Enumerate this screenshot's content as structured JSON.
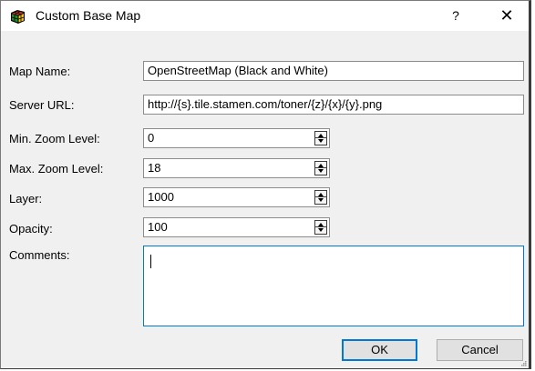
{
  "window": {
    "title": "Custom Base Map",
    "help_label": "?",
    "close_label": "✕"
  },
  "form": {
    "map_name_label": "Map Name:",
    "map_name_value": "OpenStreetMap (Black and White)",
    "server_url_label": "Server URL:",
    "server_url_value": "http://{s}.tile.stamen.com/toner/{z}/{x}/{y}.png",
    "min_zoom_label": "Min. Zoom Level:",
    "min_zoom_value": "0",
    "max_zoom_label": "Max. Zoom Level:",
    "max_zoom_value": "18",
    "layer_label": "Layer:",
    "layer_value": "1000",
    "opacity_label": "Opacity:",
    "opacity_value": "100",
    "comments_label": "Comments:",
    "comments_value": ""
  },
  "buttons": {
    "ok_label": "OK",
    "cancel_label": "Cancel"
  },
  "icons": {
    "app": "cube-map-icon",
    "spin": "spinner-arrows-icon"
  }
}
